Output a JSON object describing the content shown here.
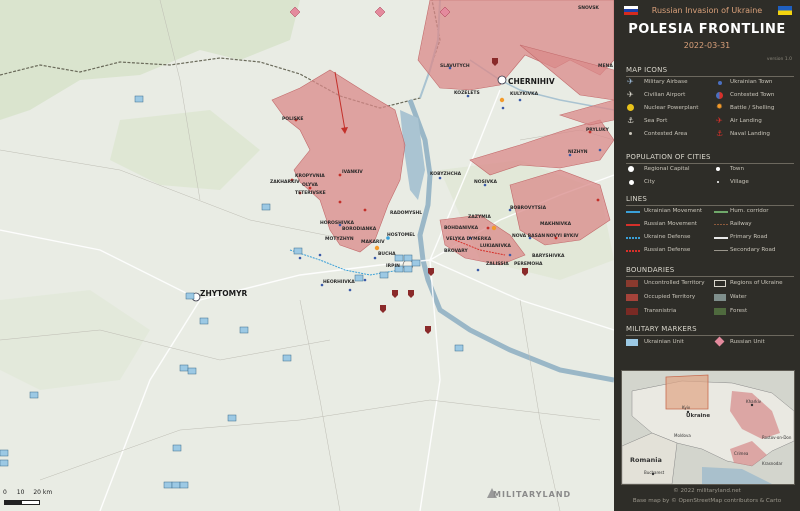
{
  "header": {
    "subtitle": "Russian Invasion of Ukraine",
    "title": "POLESIA FRONTLINE",
    "date": "2022-03-31",
    "version": "version 1.0"
  },
  "colors": {
    "occupied": "#d9898a",
    "uncontrolled": "#8a3a2e",
    "transnistria": "#7a2a24",
    "water": "#7f8f8c",
    "forest": "#4f6a3e",
    "ukraine_unit": "#9cc9e4",
    "russian_unit": "#e48a9d",
    "panel_bg": "#2e2d28",
    "accent": "#d9a07a"
  },
  "legend": {
    "map_icons_title": "MAP ICONS",
    "map_icons": [
      {
        "label": "Military Airbase",
        "icon": "airbase-icon"
      },
      {
        "label": "Ukrainian Town",
        "icon": "ukrainian-town-icon"
      },
      {
        "label": "Civilian Airport",
        "icon": "airport-icon"
      },
      {
        "label": "Contested Town",
        "icon": "contested-town-icon"
      },
      {
        "label": "Nuclear Powerplant",
        "icon": "nuclear-icon"
      },
      {
        "label": "Battle / Shelling",
        "icon": "battle-icon"
      },
      {
        "label": "Sea Port",
        "icon": "anchor-icon"
      },
      {
        "label": "Air Landing",
        "icon": "air-landing-icon"
      },
      {
        "label": "Contested Area",
        "icon": "contested-area-icon"
      },
      {
        "label": "Naval Landing",
        "icon": "naval-landing-icon"
      }
    ],
    "population_title": "POPULATION OF CITIES",
    "population": [
      {
        "label": "Regional Capital"
      },
      {
        "label": "Town"
      },
      {
        "label": "City"
      },
      {
        "label": "Village"
      }
    ],
    "lines_title": "LINES",
    "lines": [
      {
        "label": "Ukrainian Movement",
        "color": "#3aa0d8"
      },
      {
        "label": "Hum. corridor",
        "color": "#6fa86a"
      },
      {
        "label": "Russian Movement",
        "color": "#d6302a"
      },
      {
        "label": "Railway",
        "color": "#8c5a3c"
      },
      {
        "label": "Ukraine Defense",
        "color": "#3aa0d8"
      },
      {
        "label": "Primary Road",
        "color": "#e8e8e8"
      },
      {
        "label": "Russian Defense",
        "color": "#d6302a"
      },
      {
        "label": "Secondary Road",
        "color": "#9a968c"
      }
    ],
    "boundaries_title": "BOUNDARIES",
    "boundaries": [
      {
        "label": "Uncontrolled Territory"
      },
      {
        "label": "Regions of Ukraine"
      },
      {
        "label": "Occupied Territory"
      },
      {
        "label": "Water"
      },
      {
        "label": "Transnistria"
      },
      {
        "label": "Forest"
      }
    ],
    "markers_title": "MILITARY MARKERS",
    "markers": [
      {
        "label": "Ukrainian Unit"
      },
      {
        "label": "Russian Unit"
      }
    ]
  },
  "inset": {
    "ukraine": "Ukraine",
    "romania": "Romania",
    "moldova": "Moldova",
    "bucharest": "Bucharest",
    "crimea": "Crimea",
    "kyiv": "Kyiv",
    "kharkiv": "Kharkiv",
    "rostov": "Rostov-on-Don",
    "krasnodar": "Krasnodar"
  },
  "footer": {
    "copyright": "© 2022 militaryland.net",
    "basemap": "Base map by © OpenStreetMap contributors & Carto"
  },
  "map": {
    "big_cities": {
      "chernihiv": "CHERNIHIV",
      "zhytomyr": "ZHYTOMYR"
    },
    "towns": [
      "SNOVSK",
      "SLAVUTYCH",
      "KOZELETS",
      "KOZELETS",
      "POLISKE",
      "IVANKIV",
      "KROPYVNIA",
      "ZAKHARKIV",
      "OLYVA",
      "TETERIVSKE",
      "RADOMYSHL",
      "HOROSHIVKA",
      "BORODIANKA",
      "MOTYZHYN",
      "MAKARIV",
      "HOSTOMEL",
      "BUCHA",
      "IRPIN",
      "BROVARY",
      "BARYSHIVKA",
      "MAKHNIVKA",
      "NOVA BASAN",
      "NOVYI BYKIV",
      "BOBROVYTSIA",
      "NIZHYN",
      "NOSIVKA",
      "KOBYZHCHA",
      "KULYKIVKA",
      "MENA",
      "PRYLUKY",
      "ZAZYMIA",
      "BOHDANIVKA",
      "LUKIANIVKA",
      "VELYKA DYMERKA",
      "ZALISSIA",
      "PEREMOHA",
      "HEORHIIVKA"
    ],
    "scale": {
      "z0": "0",
      "z10": "10",
      "z20": "20 km"
    },
    "brand": "MILITARYLAND"
  }
}
